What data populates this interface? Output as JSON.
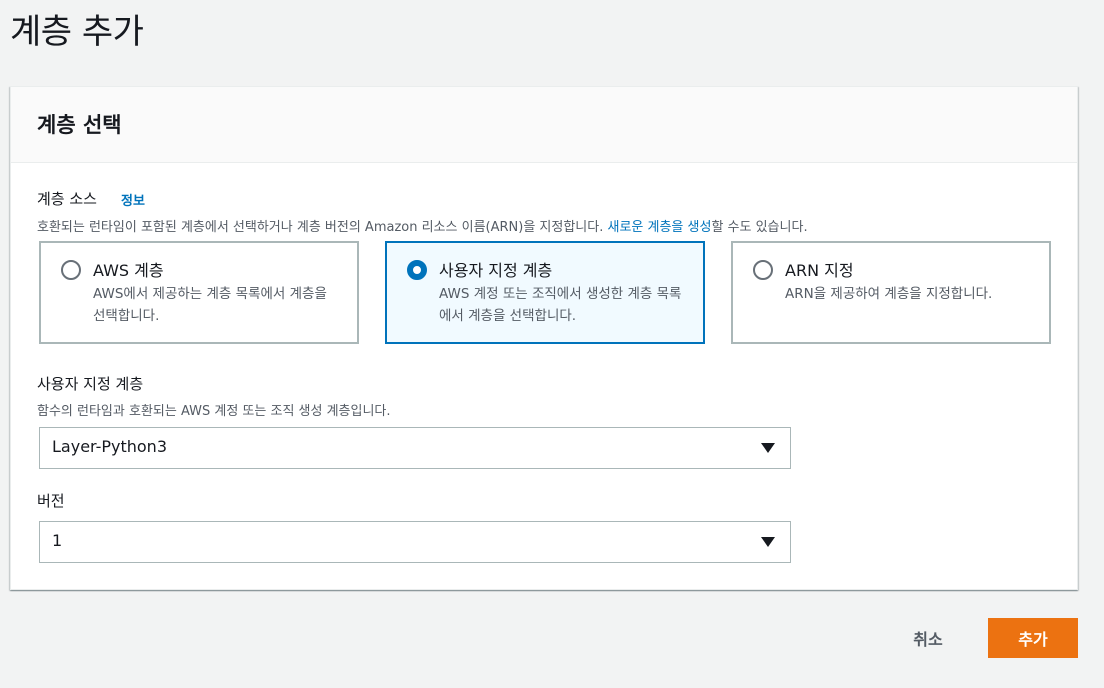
{
  "page": {
    "title": "계층 추가"
  },
  "panel": {
    "title": "계층 선택",
    "layer_source": {
      "label": "계층 소스",
      "info_link": "정보",
      "description_prefix": "호환되는 런타임이 포함된 계층에서 선택하거나 계층 버전의 Amazon 리소스 이름(ARN)을 지정합니다.",
      "description_link": "새로운 계층을 생성",
      "description_suffix": "할 수도 있습니다.",
      "options": [
        {
          "title": "AWS 계층",
          "description": "AWS에서 제공하는 계층 목록에서 계층을 선택합니다.",
          "selected": false
        },
        {
          "title": "사용자 지정 계층",
          "description": "AWS 계정 또는 조직에서 생성한 계층 목록에서 계층을 선택합니다.",
          "selected": true
        },
        {
          "title": "ARN 지정",
          "description": "ARN을 제공하여 계층을 지정합니다.",
          "selected": false
        }
      ]
    },
    "custom_layer": {
      "label": "사용자 지정 계층",
      "description": "함수의 런타임과 호환되는 AWS 계정 또는 조직 생성 계층입니다.",
      "selected_value": "Layer-Python3"
    },
    "version": {
      "label": "버전",
      "selected_value": "1"
    }
  },
  "footer": {
    "cancel_label": "취소",
    "add_label": "추가"
  },
  "colors": {
    "accent": "#0073bb",
    "primary_button": "#ec7211",
    "selected_tile_bg": "#f1faff"
  }
}
